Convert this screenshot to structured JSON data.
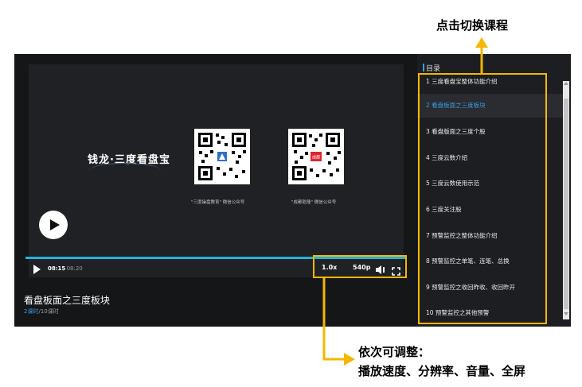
{
  "video": {
    "slide_title": "钱龙·三度看盘宝",
    "qr_caption_1": "\"三度操盘教育\" 微信公众号",
    "qr_caption_2": "\"成都乾隆\" 微信公众号",
    "qr2_badge": "成都"
  },
  "controls": {
    "current_time": "08:15",
    "separator_total": "/ 08:20",
    "speed": "1.0x",
    "quality": "540p"
  },
  "course": {
    "title": "看盘板面之三度板块",
    "lesson_current": "2课时",
    "lesson_total": "/10课时"
  },
  "sidebar": {
    "title": "目录",
    "items": [
      {
        "label": "1  三度看盘宝整体功能介绍"
      },
      {
        "label": "2  看盘板面之三度板块"
      },
      {
        "label": "3  看盘版面之三度个股"
      },
      {
        "label": "4  三度云数介绍"
      },
      {
        "label": "5  三度云数使用示范"
      },
      {
        "label": "6  三度关注股"
      },
      {
        "label": "7  预警监控之整体功能介绍"
      },
      {
        "label": "8  预警监控之单笔、连笔、总换"
      },
      {
        "label": "9  预警监控之收回昨收、收回昨开"
      },
      {
        "label": "10  预警监控之其他预警"
      }
    ]
  },
  "annotations": {
    "top_note": "点击切换课程",
    "bottom_note_1": "依次可调整：",
    "bottom_note_2": "播放速度、分辨率、音量、全屏",
    "color": "#f5b700"
  }
}
